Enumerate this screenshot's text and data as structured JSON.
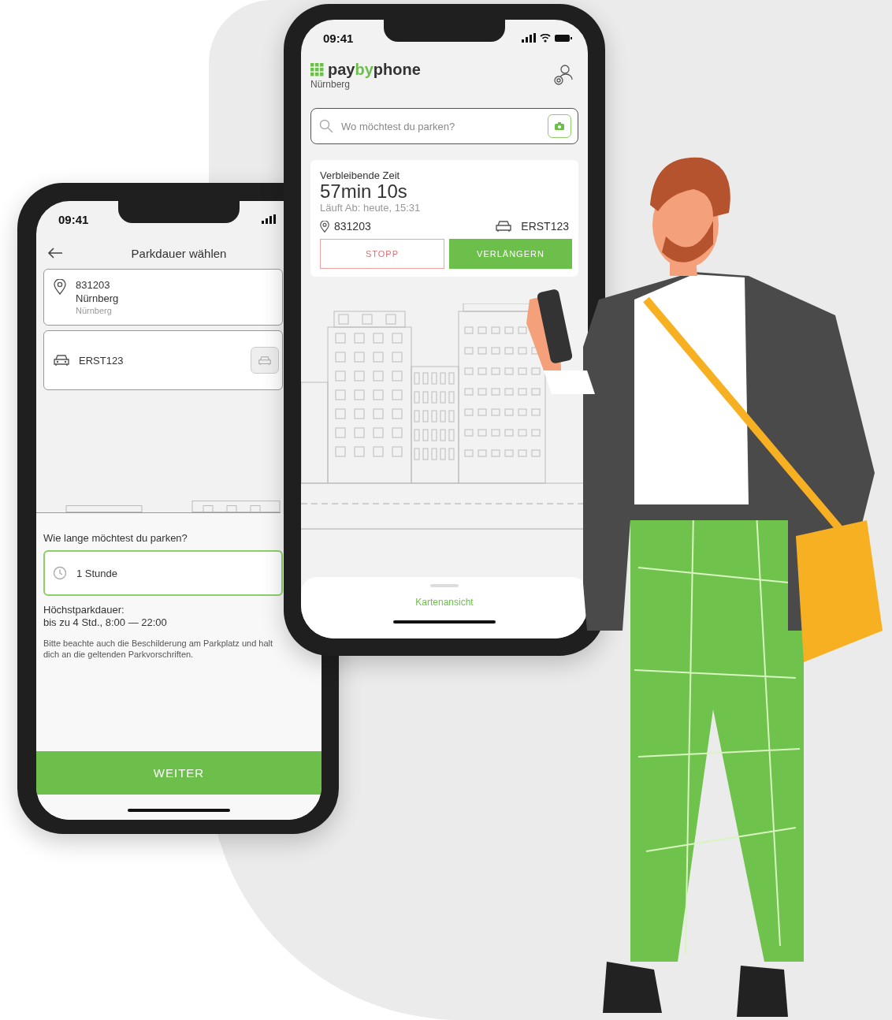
{
  "back_phone": {
    "status_time": "09:41",
    "title": "Parkdauer wählen",
    "location": {
      "zone": "831203",
      "city": "Nürnberg",
      "area": "Nürnberg"
    },
    "vehicle": {
      "plate": "ERST123"
    },
    "duration_question": "Wie lange möchtest du parken?",
    "duration": {
      "value": "1 Stunde"
    },
    "max_label": "Höchstparkdauer:",
    "max_value": "bis zu 4 Std., 8:00 — 22:00",
    "notice": "Bitte beachte auch die Beschilderung am Parkplatz und halt dich an die geltenden Parkvorschriften.",
    "continue_button": "WEITER"
  },
  "front_phone": {
    "status_time": "09:41",
    "brand": {
      "prefix": "pay",
      "highlight": "by",
      "suffix": "phone"
    },
    "city": "Nürnberg",
    "search": {
      "placeholder": "Wo möchtest du parken?"
    },
    "session": {
      "label": "Verbleibende Zeit",
      "remaining": "57min 10s",
      "expires": "Läuft Ab: heute, 15:31",
      "zone": "831203",
      "plate": "ERST123"
    },
    "buttons": [
      {
        "label": "STOPP",
        "kind": "outline"
      },
      {
        "label": "VERLÄNGERN",
        "kind": "primary"
      }
    ],
    "map_link": "Kartenansicht"
  }
}
